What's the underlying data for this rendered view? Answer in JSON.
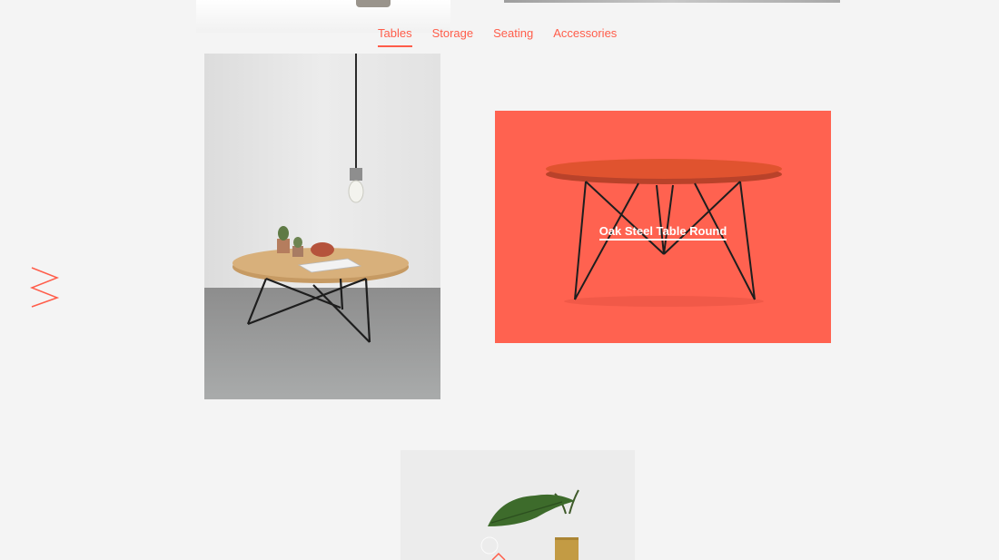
{
  "nav": {
    "items": [
      {
        "label": "Tables",
        "active": true
      },
      {
        "label": "Storage",
        "active": false
      },
      {
        "label": "Seating",
        "active": false
      },
      {
        "label": "Accessories",
        "active": false
      }
    ]
  },
  "featured": {
    "title": "Oak Steel Table Round"
  },
  "colors": {
    "accent": "#ff5d4a",
    "feature_background": "#ff6250",
    "page_background": "#f4f4f4"
  },
  "icons": {
    "decor": "zigzag-icon"
  }
}
